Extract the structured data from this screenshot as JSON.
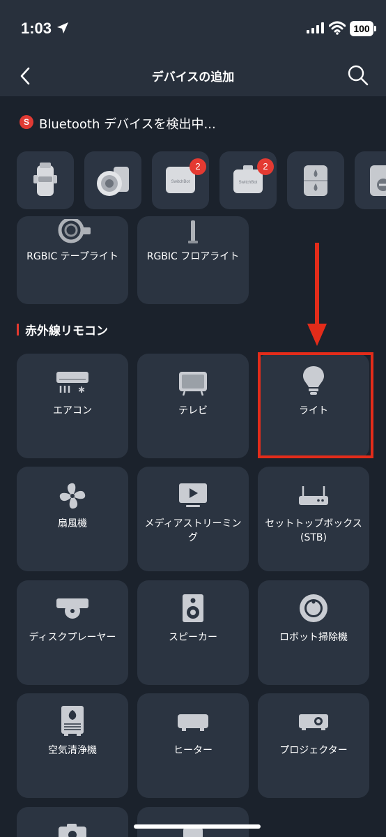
{
  "status_bar": {
    "time": "1:03",
    "battery": "100"
  },
  "nav": {
    "title": "デバイスの追加"
  },
  "scanning": {
    "badge": "S",
    "text": "Bluetooth デバイスを検出中..."
  },
  "bluetooth_devices": [
    {
      "icon": "switchbot-bot-icon"
    },
    {
      "icon": "robot-vacuum-dock-icon"
    },
    {
      "icon": "switchbot-hub-icon",
      "label": "SwitchBot",
      "badge": "2"
    },
    {
      "icon": "switchbot-hub-mini-icon",
      "label": "SwitchBot",
      "badge": "2"
    },
    {
      "icon": "water-leak-sensor-icon"
    },
    {
      "icon": "smart-lock-icon"
    }
  ],
  "wifi_lights": [
    {
      "label": "RGBIC テープライト",
      "icon": "tape-light-icon"
    },
    {
      "label": "RGBIC フロアライト",
      "icon": "floor-light-icon"
    }
  ],
  "ir_section": {
    "title": "赤外線リモコン",
    "items": [
      {
        "label": "エアコン",
        "icon": "air-conditioner-icon"
      },
      {
        "label": "テレビ",
        "icon": "tv-icon"
      },
      {
        "label": "ライト",
        "icon": "light-bulb-icon"
      },
      {
        "label": "扇風機",
        "icon": "fan-icon"
      },
      {
        "label": "メディアストリーミング",
        "icon": "media-streaming-icon"
      },
      {
        "label": "セットトップボックス(STB)",
        "icon": "set-top-box-icon"
      },
      {
        "label": "ディスクプレーヤー",
        "icon": "disc-player-icon"
      },
      {
        "label": "スピーカー",
        "icon": "speaker-icon"
      },
      {
        "label": "ロボット掃除機",
        "icon": "robot-vacuum-icon"
      },
      {
        "label": "空気清浄機",
        "icon": "air-purifier-icon"
      },
      {
        "label": "ヒーター",
        "icon": "heater-icon"
      },
      {
        "label": "プロジェクター",
        "icon": "projector-icon"
      },
      {
        "label": "",
        "icon": "camera-icon"
      },
      {
        "label": "",
        "icon": "other-device-icon"
      }
    ]
  },
  "colors": {
    "background": "#1b222c",
    "card": "#2b3441",
    "accent_red": "#e32c1a",
    "icon_gray": "#c9ccd2"
  }
}
